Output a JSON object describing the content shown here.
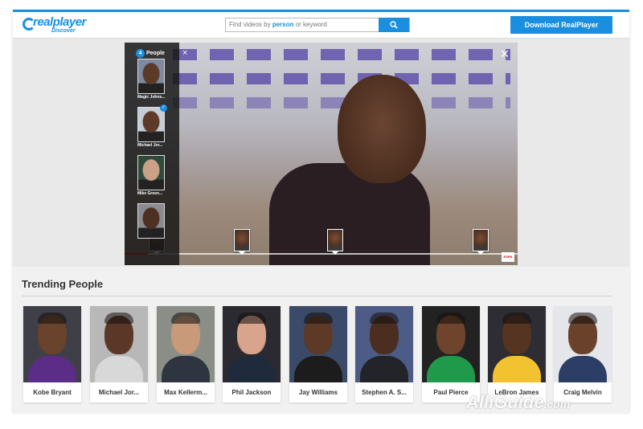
{
  "header": {
    "logo_main": "realplayer",
    "logo_sub": "Discover",
    "search": {
      "placeholder_prefix": "Find videos by ",
      "placeholder_highlight": "person",
      "placeholder_suffix": " or keyword"
    },
    "download_label": "Download RealPlayer"
  },
  "people_panel": {
    "count": "4",
    "title": "People",
    "close": "×",
    "people": [
      {
        "name": "Magic Johns...",
        "skin": "#5b3a28",
        "bg": "#7d8aa0",
        "selected": false
      },
      {
        "name": "Michael Jor...",
        "skin": "#5e3b29",
        "bg": "#c7cdd6",
        "selected": true
      },
      {
        "name": "Mike Green...",
        "skin": "#caa087",
        "bg": "#2f4a3a",
        "selected": false
      },
      {
        "name": "",
        "skin": "#4e3022",
        "bg": "#8a8a90",
        "selected": false
      }
    ]
  },
  "player": {
    "close": "×",
    "markers": [
      {
        "label": ""
      },
      {
        "label": ""
      },
      {
        "label": "0:11"
      },
      {
        "label": ""
      }
    ],
    "progress": 0.06,
    "badge": "ESPN"
  },
  "trending": {
    "title": "Trending People",
    "people": [
      {
        "name": "Kobe Bryant",
        "skin": "#6a432c",
        "bg": "#3f3f48",
        "shirt": "#5b2d86"
      },
      {
        "name": "Michael Jor...",
        "skin": "#5a3726",
        "bg": "#b8b8b8",
        "shirt": "#d8d8d8"
      },
      {
        "name": "Max Kellerm...",
        "skin": "#c89a7a",
        "bg": "#8a8e86",
        "shirt": "#2e3540"
      },
      {
        "name": "Phil Jackson",
        "skin": "#d8a48c",
        "bg": "#2a2a30",
        "shirt": "#1f2a3c"
      },
      {
        "name": "Jay Williams",
        "skin": "#5c3a27",
        "bg": "#3b4a68",
        "shirt": "#1c1c1c"
      },
      {
        "name": "Stephen A. S...",
        "skin": "#4c2e20",
        "bg": "#4c5c86",
        "shirt": "#23242a"
      },
      {
        "name": "Paul Pierce",
        "skin": "#6e442c",
        "bg": "#222222",
        "shirt": "#1f9a4a"
      },
      {
        "name": "LeBron James",
        "skin": "#553421",
        "bg": "#2d2d33",
        "shirt": "#f2c230"
      },
      {
        "name": "Craig Melvin",
        "skin": "#6a412a",
        "bg": "#e4e6ea",
        "shirt": "#2c3e66"
      }
    ]
  },
  "watermark": {
    "main": "AlliGuide",
    "domain": ".com"
  }
}
